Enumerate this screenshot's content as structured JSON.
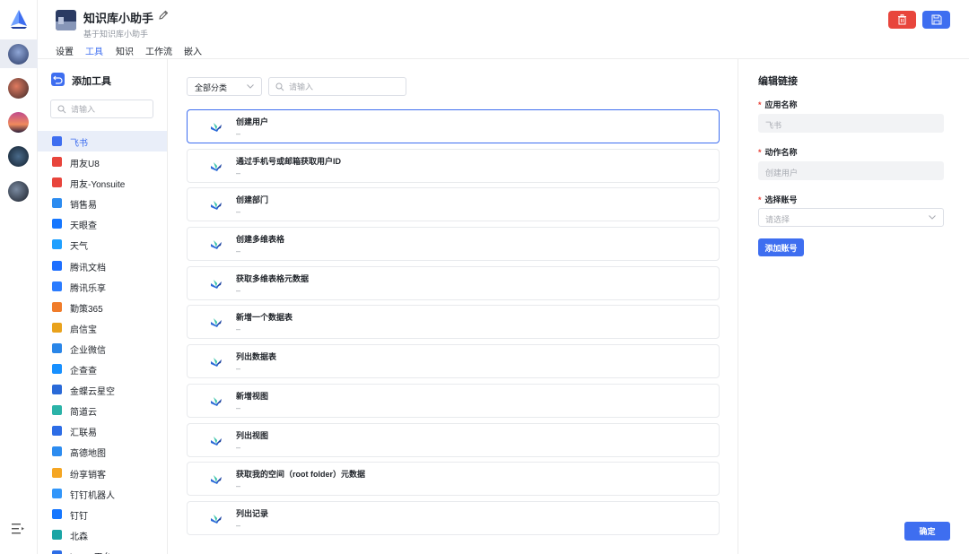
{
  "header": {
    "app_title": "知识库小助手",
    "app_subtitle": "基于知识库小助手"
  },
  "tabs": [
    {
      "label": "设置"
    },
    {
      "label": "工具",
      "active": true
    },
    {
      "label": "知识"
    },
    {
      "label": "工作流"
    },
    {
      "label": "嵌入"
    }
  ],
  "sidebar": {
    "title": "添加工具",
    "search_placeholder": "请输入",
    "items": [
      {
        "label": "飞书",
        "icon": "feishu-icon",
        "color": "#3e6ef0",
        "active": true
      },
      {
        "label": "用友U8",
        "icon": "yonyou-icon",
        "color": "#e8453c"
      },
      {
        "label": "用友-Yonsuite",
        "icon": "yonsuite-icon",
        "color": "#e8453c"
      },
      {
        "label": "销售易",
        "icon": "xiaoshouyi-icon",
        "color": "#2d8cf0"
      },
      {
        "label": "天眼查",
        "icon": "tianyancha-icon",
        "color": "#1677ff"
      },
      {
        "label": "天气",
        "icon": "weather-icon",
        "color": "#20a0ff"
      },
      {
        "label": "腾讯文档",
        "icon": "tencent-docs-icon",
        "color": "#1e6fff"
      },
      {
        "label": "腾讯乐享",
        "icon": "tencent-lexiang-icon",
        "color": "#2b7cff"
      },
      {
        "label": "勤策365",
        "icon": "qince-icon",
        "color": "#f07c2a"
      },
      {
        "label": "启信宝",
        "icon": "qixinbao-icon",
        "color": "#e9a21c"
      },
      {
        "label": "企业微信",
        "icon": "wecom-icon",
        "color": "#2a86e8"
      },
      {
        "label": "企查查",
        "icon": "qichacha-icon",
        "color": "#1890ff"
      },
      {
        "label": "金蝶云星空",
        "icon": "kingdee-icon",
        "color": "#2a6ad8"
      },
      {
        "label": "简道云",
        "icon": "jiandaoyun-icon",
        "color": "#2bb3a8"
      },
      {
        "label": "汇联易",
        "icon": "huilianyi-icon",
        "color": "#2d6de6"
      },
      {
        "label": "高德地图",
        "icon": "amap-icon",
        "color": "#2d8cf0"
      },
      {
        "label": "纷享销客",
        "icon": "fxiaoke-icon",
        "color": "#f5a623"
      },
      {
        "label": "钉钉机器人",
        "icon": "dingtalk-robot-icon",
        "color": "#3296fa"
      },
      {
        "label": "钉钉",
        "icon": "dingtalk-icon",
        "color": "#1677ff"
      },
      {
        "label": "北森",
        "icon": "beisen-icon",
        "color": "#1aa5a5"
      },
      {
        "label": "iPaaS平台",
        "icon": "ipaas-icon",
        "color": "#2d6de6"
      }
    ]
  },
  "main": {
    "category_select": "全部分类",
    "search_placeholder": "请输入",
    "actions": [
      {
        "name": "创建用户",
        "desc": "–",
        "active": true
      },
      {
        "name": "通过手机号或邮箱获取用户ID",
        "desc": "–"
      },
      {
        "name": "创建部门",
        "desc": "–"
      },
      {
        "name": "创建多维表格",
        "desc": "–"
      },
      {
        "name": "获取多维表格元数据",
        "desc": "–"
      },
      {
        "name": "新增一个数据表",
        "desc": "–"
      },
      {
        "name": "列出数据表",
        "desc": "–"
      },
      {
        "name": "新增视图",
        "desc": "–"
      },
      {
        "name": "列出视图",
        "desc": "–"
      },
      {
        "name": "获取我的空间（root folder）元数据",
        "desc": "–"
      },
      {
        "name": "列出记录",
        "desc": "–"
      }
    ]
  },
  "panel": {
    "title": "编辑链接",
    "app_name_label": "应用名称",
    "app_name_value": "飞书",
    "action_name_label": "动作名称",
    "action_name_value": "创建用户",
    "account_label": "选择账号",
    "account_placeholder": "请选择",
    "add_account_label": "添加账号",
    "confirm_label": "确定",
    "required_mark": "*"
  },
  "colors": {
    "accent": "#3e6ef0",
    "danger": "#e8453c"
  }
}
